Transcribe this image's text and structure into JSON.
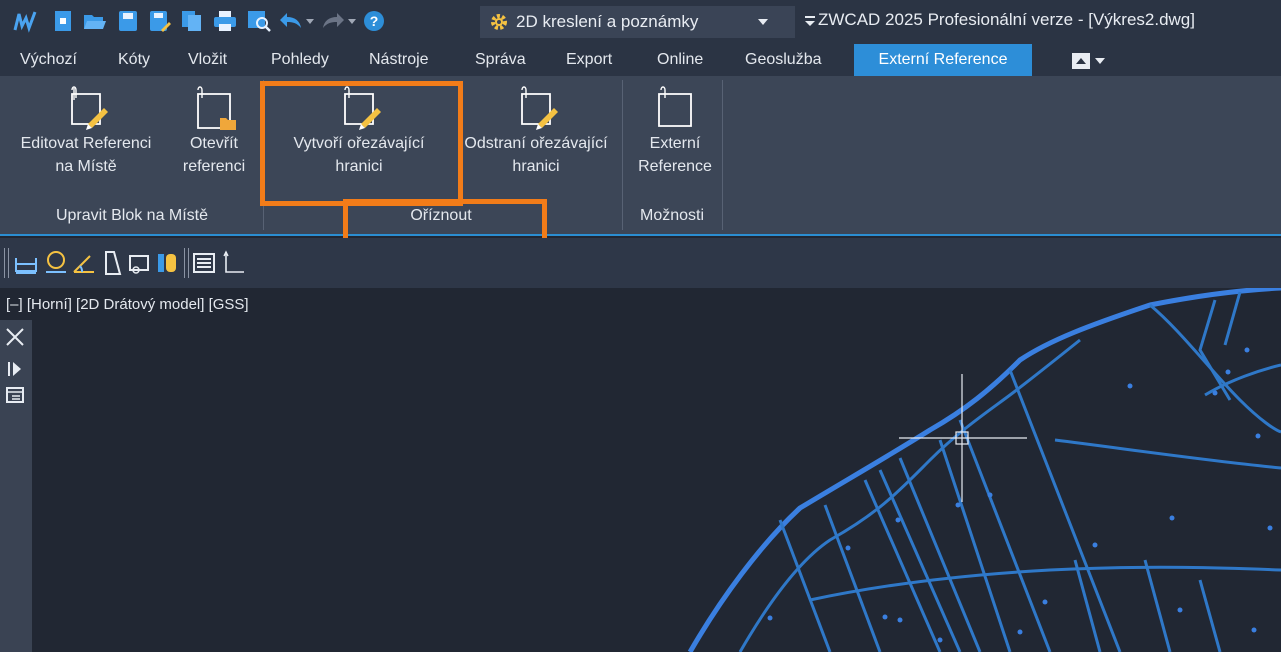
{
  "title": {
    "workspace": "2D kreslení a poznámky",
    "app_title": "ZWCAD 2025 Profesionální verze - [Výkres2.dwg]"
  },
  "quick_access": [
    "app-logo-icon",
    "new-icon",
    "open-icon",
    "save-icon",
    "save-as-icon",
    "copy-icon",
    "print-icon",
    "preview-icon",
    "undo-icon",
    "redo-icon",
    "help-icon",
    "workspace-gear-icon"
  ],
  "tabs": [
    "Výchozí",
    "Kóty",
    "Vložit",
    "Pohledy",
    "Nástroje",
    "Správa",
    "Export",
    "Online",
    "Geoslužba",
    "Externí Reference"
  ],
  "active_tab": "Externí Reference",
  "ribbon": {
    "buttons": [
      {
        "line1": "Editovat Referenci",
        "line2": "na Místě"
      },
      {
        "line1": "Otevřít",
        "line2": "referenci"
      },
      {
        "line1": "Vytvoří ořezávající",
        "line2": "hranici"
      },
      {
        "line1": "Odstraní ořezávající",
        "line2": "hranici"
      },
      {
        "line1": "Externí",
        "line2": "Reference"
      }
    ],
    "panels": [
      "Upravit Blok na Místě",
      "Oříznout",
      "Možnosti"
    ]
  },
  "viewport": {
    "label": "[–] [Horní] [2D Drátový model] [GSS]"
  },
  "colors": {
    "accent": "#2d8ed8",
    "highlight": "#f27c19",
    "drawing": "#2f78c8",
    "drawing_bold": "#3a7fe0"
  }
}
